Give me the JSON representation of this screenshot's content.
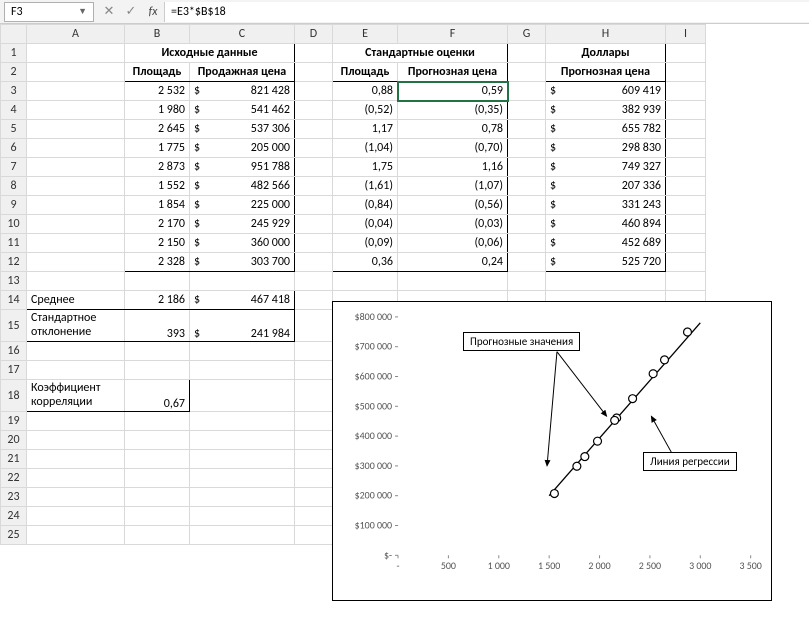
{
  "namebox": "F3",
  "formula": "=E3*$B$18",
  "columns": [
    "A",
    "B",
    "C",
    "D",
    "E",
    "F",
    "G",
    "H",
    "I"
  ],
  "rows": [
    "1",
    "2",
    "3",
    "4",
    "5",
    "6",
    "7",
    "8",
    "9",
    "10",
    "11",
    "12",
    "13",
    "14",
    "15",
    "16",
    "17",
    "18",
    "19",
    "20",
    "21",
    "22",
    "23",
    "24",
    "25"
  ],
  "headers": {
    "src_title": "Исходные данные",
    "src_area": "Площадь",
    "src_price": "Продажная цена",
    "std_title": "Стандартные оценки",
    "std_area": "Площадь",
    "std_price": "Прогнозная цена",
    "usd_title": "Доллары",
    "usd_price": "Прогнозная цена"
  },
  "source": [
    {
      "area": "2 532",
      "price": "821 428"
    },
    {
      "area": "1 980",
      "price": "541 462"
    },
    {
      "area": "2 645",
      "price": "537 306"
    },
    {
      "area": "1 775",
      "price": "205 000"
    },
    {
      "area": "2 873",
      "price": "951 788"
    },
    {
      "area": "1 552",
      "price": "482 566"
    },
    {
      "area": "1 854",
      "price": "225 000"
    },
    {
      "area": "2 170",
      "price": "245 929"
    },
    {
      "area": "2 150",
      "price": "360 000"
    },
    {
      "area": "2 328",
      "price": "303 700"
    }
  ],
  "std": [
    {
      "area": "0,88",
      "price": "0,59"
    },
    {
      "area": "(0,52)",
      "price": "(0,35)"
    },
    {
      "area": "1,17",
      "price": "0,78"
    },
    {
      "area": "(1,04)",
      "price": "(0,70)"
    },
    {
      "area": "1,75",
      "price": "1,16"
    },
    {
      "area": "(1,61)",
      "price": "(1,07)"
    },
    {
      "area": "(0,84)",
      "price": "(0,56)"
    },
    {
      "area": "(0,04)",
      "price": "(0,03)"
    },
    {
      "area": "(0,09)",
      "price": "(0,06)"
    },
    {
      "area": "0,36",
      "price": "0,24"
    }
  ],
  "usd": [
    "609 419",
    "382 939",
    "655 782",
    "298 830",
    "749 327",
    "207 336",
    "331 243",
    "460 894",
    "452 689",
    "525 720"
  ],
  "stats": {
    "mean_label": "Среднее",
    "mean_area": "2 186",
    "mean_price": "467 418",
    "stdev_label": "Стандартное отклонение",
    "stdev_area": "393",
    "stdev_price": "241 984",
    "corr_label": "Коэффициент корреляции",
    "corr_val": "0,67"
  },
  "chart": {
    "ann_forecast": "Прогнозные значения",
    "ann_regline": "Линия регрессии",
    "yticks": [
      "$800 000",
      "$700 000",
      "$600 000",
      "$500 000",
      "$400 000",
      "$300 000",
      "$200 000",
      "$100 000",
      "$-"
    ],
    "xticks": [
      "-",
      "500",
      "1 000",
      "1 500",
      "2 000",
      "2 500",
      "3 000",
      "3 500"
    ]
  },
  "chart_data": {
    "type": "scatter",
    "title": "",
    "xlabel": "",
    "ylabel": "",
    "xlim": [
      0,
      3500
    ],
    "ylim": [
      0,
      800000
    ],
    "series": [
      {
        "name": "Прогнозные значения",
        "x": [
          2532,
          1980,
          2645,
          1775,
          2873,
          1552,
          1854,
          2170,
          2150,
          2328
        ],
        "y": [
          609419,
          382939,
          655782,
          298830,
          749327,
          207336,
          331243,
          460894,
          452689,
          525720
        ]
      }
    ],
    "regression_line": {
      "x": [
        1500,
        3000
      ],
      "y": [
        200000,
        780000
      ]
    },
    "annotations": [
      "Прогнозные значения",
      "Линия регрессии"
    ]
  },
  "dollar_sym": "$"
}
